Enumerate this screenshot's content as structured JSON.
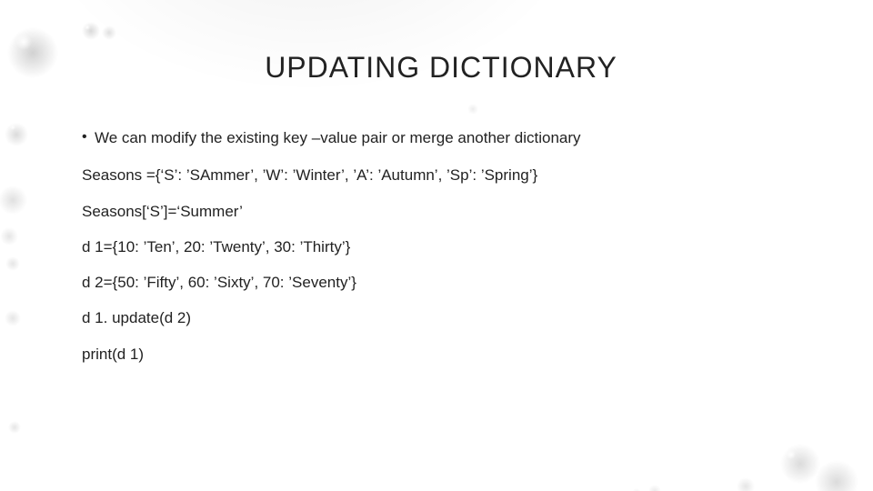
{
  "slide": {
    "title": "UPDATING DICTIONARY",
    "bullet": "We can modify the existing key –value pair or merge another dictionary",
    "lines": [
      "Seasons ={‘S’: ’SAmmer’, ’W’: ’Winter’, ’A’: ’Autumn’, ’Sp’: ’Spring’}",
      "Seasons[‘S’]=‘Summer’",
      "d 1={10: ’Ten’, 20: ’Twenty’, 30: ’Thirty’}",
      "d 2={50: ’Fifty’, 60: ’Sixty’, 70: ’Seventy’}",
      "d 1. update(d 2)",
      "print(d 1)"
    ]
  }
}
